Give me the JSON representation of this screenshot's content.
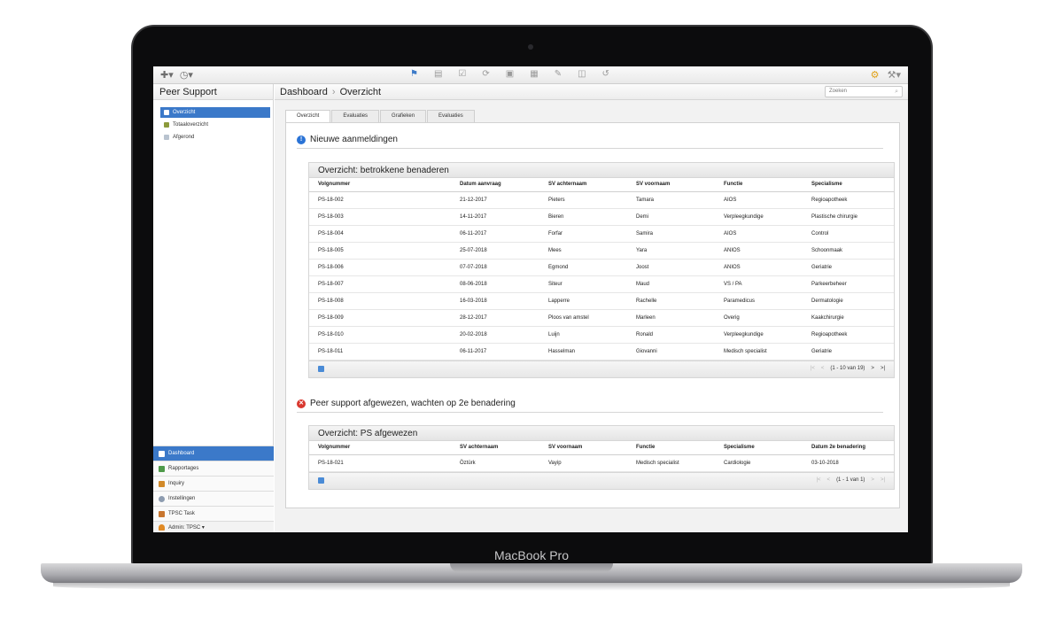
{
  "device_label": "MacBook Pro",
  "toolbar": {
    "left_icons": [
      "add-icon",
      "dashboard-clock-icon"
    ],
    "center_icons": [
      "home-icon",
      "document-icon",
      "checklist-icon",
      "refresh-icon",
      "save-icon",
      "table-icon",
      "edit-icon",
      "trash-icon",
      "undo-icon"
    ],
    "right_icons": [
      "user-lock-icon",
      "tools-icon"
    ]
  },
  "sidebar": {
    "title": "Peer Support",
    "items": [
      {
        "label": "Overzicht",
        "selected": true,
        "icon": "list-icon"
      },
      {
        "label": "Totaaloverzicht",
        "selected": false,
        "icon": "folder-icon"
      },
      {
        "label": "Afgerond",
        "selected": false,
        "icon": "archive-icon"
      }
    ],
    "nav": [
      {
        "label": "Dashboard",
        "selected": true,
        "icon": "dashboard-icon"
      },
      {
        "label": "Rapportages",
        "selected": false,
        "icon": "report-icon"
      },
      {
        "label": "Inquiry",
        "selected": false,
        "icon": "inquiry-icon"
      },
      {
        "label": "Instellingen",
        "selected": false,
        "icon": "settings-icon"
      },
      {
        "label": "TPSC Task",
        "selected": false,
        "icon": "task-icon"
      }
    ],
    "admin": "Admin: TPSC ▾"
  },
  "breadcrumb": {
    "root": "Dashboard",
    "separator": "›",
    "current": "Overzicht"
  },
  "search": {
    "placeholder": "Zoeken"
  },
  "tabs": [
    {
      "label": "Overzicht",
      "active": true
    },
    {
      "label": "Evaluaties",
      "active": false
    },
    {
      "label": "Grafieken",
      "active": false
    },
    {
      "label": "Evaluaties",
      "active": false
    }
  ],
  "section1": {
    "title": "Nieuwe aanmeldingen",
    "icon_color": "#2a73d6",
    "grid": {
      "title": "Overzicht: betrokkene benaderen",
      "columns": [
        "Volgnummer",
        "Datum aanvraag",
        "SV achternaam",
        "SV voornaam",
        "Functie",
        "Specialisme"
      ],
      "rows": [
        [
          "PS-18-002",
          "21-12-2017",
          "Pieters",
          "Tamara",
          "AIOS",
          "Regioapotheek"
        ],
        [
          "PS-18-003",
          "14-11-2017",
          "Bieren",
          "Demi",
          "Verpleegkundige",
          "Plastische chirurgie"
        ],
        [
          "PS-18-004",
          "06-11-2017",
          "Forfar",
          "Samira",
          "AIOS",
          "Control"
        ],
        [
          "PS-18-005",
          "25-07-2018",
          "Mees",
          "Yara",
          "ANIOS",
          "Schoonmaak"
        ],
        [
          "PS-18-006",
          "07-07-2018",
          "Egmond",
          "Joost",
          "ANIOS",
          "Geriatrie"
        ],
        [
          "PS-18-007",
          "08-06-2018",
          "Siteur",
          "Maud",
          "VS / PA",
          "Parkeerbeheer"
        ],
        [
          "PS-18-008",
          "16-03-2018",
          "Lapperre",
          "Rachelle",
          "Paramedicus",
          "Dermatologie"
        ],
        [
          "PS-18-009",
          "28-12-2017",
          "Ploos van amstel",
          "Marleen",
          "Overig",
          "Kaakchirurgie"
        ],
        [
          "PS-18-010",
          "20-02-2018",
          "Luijn",
          "Ronald",
          "Verpleegkundige",
          "Regioapotheek"
        ],
        [
          "PS-18-011",
          "06-11-2017",
          "Hasselman",
          "Giovanni",
          "Medisch specialist",
          "Geriatrie"
        ]
      ],
      "pager": {
        "first": "|<",
        "prev": "<",
        "info": "(1 - 10 van 19)",
        "next": ">",
        "last": ">|"
      }
    }
  },
  "section2": {
    "title": "Peer support afgewezen, wachten op 2e benadering",
    "icon_color": "#d9382f",
    "grid": {
      "title": "Overzicht: PS afgewezen",
      "columns": [
        "Volgnummer",
        "SV achternaam",
        "SV voornaam",
        "Functie",
        "Specialisme",
        "Datum 2e benadering"
      ],
      "rows": [
        [
          "PS-18-021",
          "Öztürk",
          "Vayip",
          "Medisch specialist",
          "Cardiologie",
          "03-10-2018"
        ]
      ],
      "pager": {
        "first": "|<",
        "prev": "<",
        "info": "(1 - 1 van 1)",
        "next": ">",
        "last": ">|"
      }
    }
  }
}
